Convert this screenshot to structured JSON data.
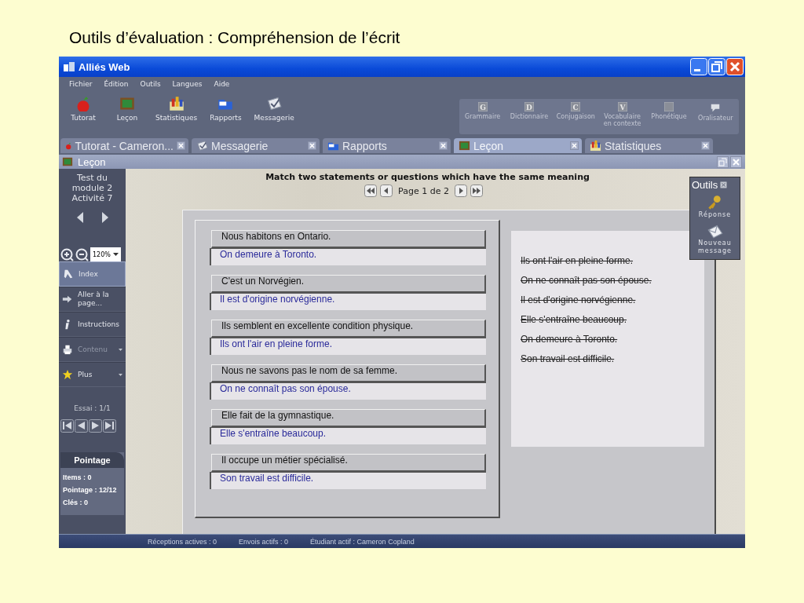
{
  "slide_title": "Outils d’évaluation : Compréhension de l’écrit",
  "window": {
    "title": "Alliés Web"
  },
  "menu": [
    "Fichier",
    "Édition",
    "Outils",
    "Langues",
    "Aide"
  ],
  "toolbar": [
    {
      "label": "Tutorat",
      "kind": "apple"
    },
    {
      "label": "Leçon",
      "kind": "board"
    },
    {
      "label": "Statistiques",
      "kind": "chart"
    },
    {
      "label": "Rapports",
      "kind": "folder"
    },
    {
      "label": "Messagerie",
      "kind": "mail"
    }
  ],
  "tools": [
    {
      "label": "Grammaire",
      "letter": "G",
      "kind": "tile",
      "disabled": true
    },
    {
      "label": "Dictionnaire",
      "letter": "D",
      "kind": "tile",
      "disabled": true
    },
    {
      "label": "Conjugaison",
      "letter": "C",
      "kind": "tile",
      "disabled": true
    },
    {
      "label": "Vocabulaire en contexte",
      "letter": "V",
      "kind": "tile",
      "disabled": true
    },
    {
      "label": "Phonétique",
      "kind": "tile",
      "disabled": true
    },
    {
      "label": "Oralisateur",
      "kind": "speech",
      "disabled": true
    }
  ],
  "tabs": [
    {
      "label": "Tutorat - Cameron...",
      "kind": "apple",
      "selected": false
    },
    {
      "label": "Messagerie",
      "kind": "mail",
      "selected": false
    },
    {
      "label": "Rapports",
      "kind": "folder",
      "selected": false
    },
    {
      "label": "Leçon",
      "kind": "board",
      "selected": true
    },
    {
      "label": "Statistiques",
      "kind": "chart",
      "selected": false
    }
  ],
  "panel": {
    "title": "Leçon"
  },
  "sidebar": {
    "activity": "Test du module 2 Activité 7",
    "zoom": "120%",
    "items": [
      {
        "label": "Index",
        "kind": "index",
        "selected": true,
        "disabled": false,
        "dropdown": false
      },
      {
        "label": "Aller à la page...",
        "kind": "goto",
        "selected": false,
        "disabled": false,
        "dropdown": false
      },
      {
        "label": "Instructions",
        "kind": "info",
        "selected": false,
        "disabled": false,
        "dropdown": false
      },
      {
        "label": "Contenu",
        "kind": "contents",
        "selected": false,
        "disabled": true,
        "dropdown": true
      },
      {
        "label": "Plus",
        "kind": "star",
        "selected": false,
        "disabled": false,
        "dropdown": true
      }
    ],
    "attempt": "Essai : 1/1",
    "score": {
      "title": "Pointage",
      "lines": [
        "Items : 0",
        "Pointage : 12/12",
        "Clés : 0"
      ]
    }
  },
  "exercise": {
    "instruction": "Match two statements or questions which have the same meaning",
    "page": "Page 1 de 2",
    "pairs": [
      {
        "statement": "Nous habitons en Ontario.",
        "answer": "On demeure à Toronto."
      },
      {
        "statement": "C'est un Norvégien.",
        "answer": "Il est d'origine norvégienne."
      },
      {
        "statement": "Ils semblent en excellente condition physique.",
        "answer": "Ils ont l'air en pleine forme."
      },
      {
        "statement": "Nous ne savons pas le nom de sa femme.",
        "answer": "On ne connaît pas son épouse."
      },
      {
        "statement": "Elle fait de la gymnastique.",
        "answer": "Elle s'entraîne beaucoup."
      },
      {
        "statement": "Il occupe un métier spécialisé.",
        "answer": "Son travail est difficile."
      }
    ],
    "choices": [
      {
        "text": "Ils ont l'air en pleine forme.",
        "used": true
      },
      {
        "text": "On ne connaît pas son épouse.",
        "used": true
      },
      {
        "text": "Il est d'origine norvégienne.",
        "used": true
      },
      {
        "text": "Elle s'entraîne beaucoup.",
        "used": true
      },
      {
        "text": "On demeure à Toronto.",
        "used": true
      },
      {
        "text": "Son travail est difficile.",
        "used": true
      }
    ]
  },
  "outils": {
    "title": "Outils",
    "items": [
      {
        "label": "Réponse",
        "kind": "key"
      },
      {
        "label": "Nouveau message",
        "kind": "envelope"
      }
    ]
  },
  "status_bar": [
    "Réceptions actives : 0",
    "Envois actifs : 0",
    "Étudiant actif : Cameron Copland"
  ]
}
